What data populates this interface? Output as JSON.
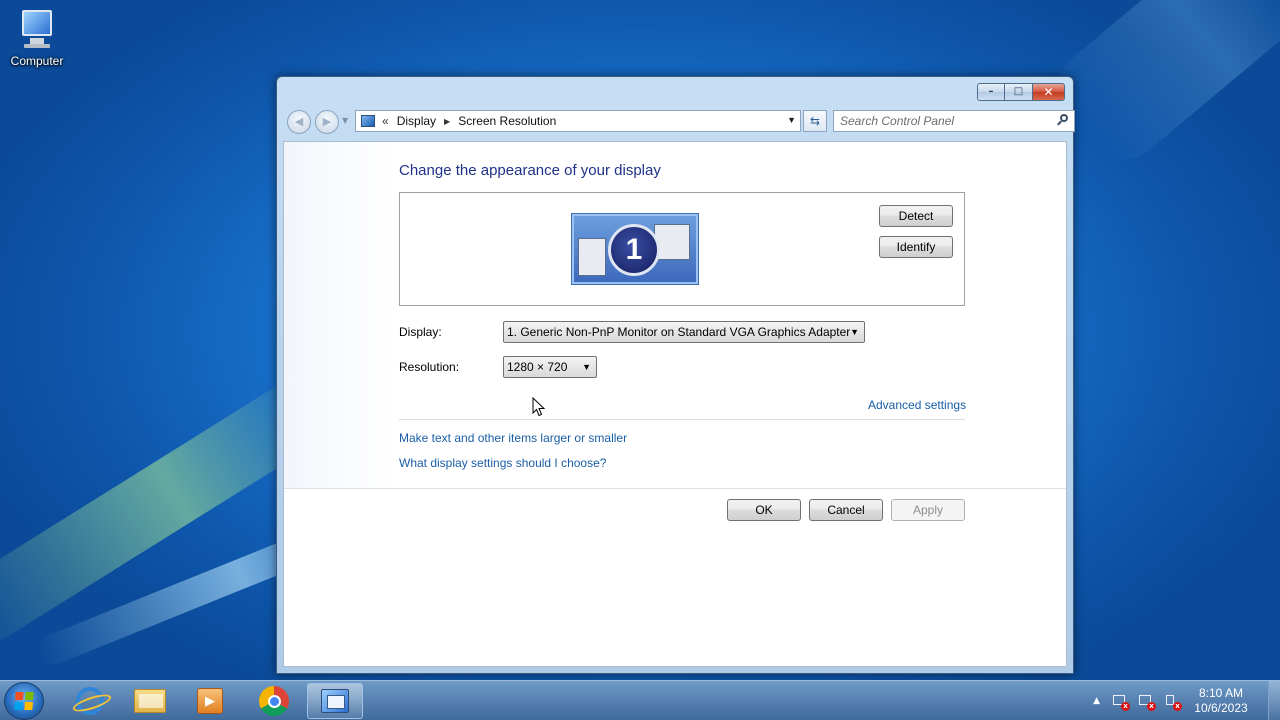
{
  "desktop": {
    "icons": [
      {
        "label": "Computer",
        "icon": "computer-icon"
      }
    ]
  },
  "window": {
    "controls": {
      "minimize": "–",
      "maximize": "□",
      "close": "✕"
    },
    "nav": {
      "back_glyph": "◀",
      "forward_glyph": "▶",
      "address_chevron": "«",
      "breadcrumbs": [
        "Display",
        "Screen Resolution"
      ],
      "breadcrumb_separator": "▶",
      "search_placeholder": "Search Control Panel",
      "refresh_glyph": "⇆"
    },
    "content": {
      "heading": "Change the appearance of your display",
      "monitor_number": "1",
      "detect_label": "Detect",
      "identify_label": "Identify",
      "display_label": "Display:",
      "display_value": "1. Generic Non-PnP Monitor on Standard VGA Graphics Adapter",
      "resolution_label": "Resolution:",
      "resolution_value": "1280 × 720",
      "advanced_link": "Advanced settings",
      "larger_link": "Make text and other items larger or smaller",
      "which_link": "What display settings should I choose?",
      "ok_label": "OK",
      "cancel_label": "Cancel",
      "apply_label": "Apply",
      "dropdown_caret": "▼"
    }
  },
  "taskbar": {
    "items": [
      {
        "name": "internet-explorer",
        "icon": "internet-explorer-icon"
      },
      {
        "name": "windows-explorer",
        "icon": "folder-icon"
      },
      {
        "name": "media-player",
        "icon": "media-player-icon"
      },
      {
        "name": "google-chrome",
        "icon": "chrome-icon"
      },
      {
        "name": "control-panel",
        "icon": "control-panel-icon",
        "active": true
      }
    ],
    "tray": {
      "expand_glyph": "▲",
      "time": "8:10 AM",
      "date": "10/6/2023"
    }
  },
  "colors": {
    "link": "#1a5ea6",
    "heading": "#1e3287",
    "desktop_blue": "#1a74d0",
    "close_red": "#c23b22"
  }
}
